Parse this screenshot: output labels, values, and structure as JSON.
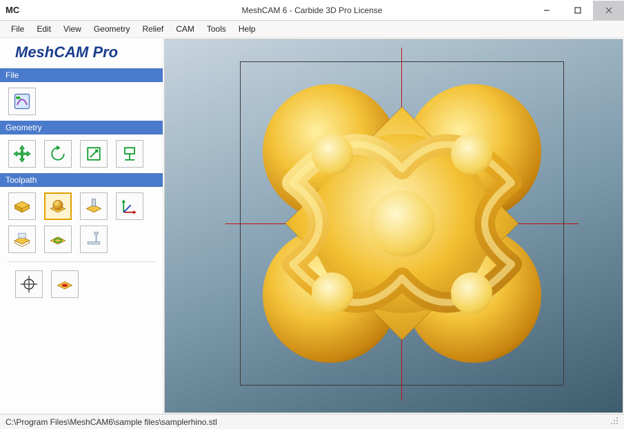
{
  "window": {
    "icon_text": "MC",
    "title": "MeshCAM 6 - Carbide 3D Pro License"
  },
  "menu": [
    "File",
    "Edit",
    "View",
    "Geometry",
    "Relief",
    "CAM",
    "Tools",
    "Help"
  ],
  "sidebar": {
    "brand": "MeshCAM Pro",
    "sections": {
      "file": {
        "label": "File"
      },
      "geometry": {
        "label": "Geometry"
      },
      "toolpath": {
        "label": "Toolpath"
      }
    }
  },
  "statusbar": {
    "path": "C:\\Program Files\\MeshCAM6\\sample files\\samplerhino.stl"
  }
}
